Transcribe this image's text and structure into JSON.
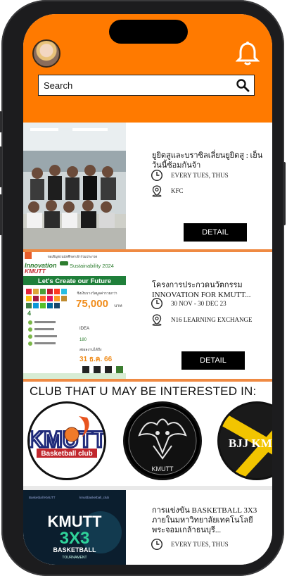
{
  "header": {
    "search_placeholder": "Search"
  },
  "events": [
    {
      "title": "ยูยิตสูและบราซิลเลี่ยนยูยิตสู : เย็นวันนี้ซ้อมกันจ้า",
      "time": "EVERY TUES, THUS",
      "location": "KFC",
      "button": "DETAIL"
    },
    {
      "title": "โครงการประกวดนวัตกรรม INNOVATION FOR KMUTT...",
      "time": "30 NOV - 30 DEC 23",
      "location": "N16 LEARNING EXCHANGE",
      "button": "DETAIL",
      "poster": {
        "heading": "Innovation for KMUTT Sustainability 2024",
        "banner": "Let's Create our Future",
        "prize": "75,000",
        "prize_unit": "บาท",
        "deadline": "31 ธ.ค. 66"
      }
    },
    {
      "title": "การแข่งขัน BASKETBALL 3X3 ภายในมหาวิทยาลัยเทคโนโลยีพระจอมเกล้าธนบุรี...",
      "time": "EVERY TUES, THUS",
      "poster": {
        "line1": "KMUTT",
        "line2": "3X3",
        "line3": "BASKETBALL",
        "line4": "TOURNAMENT"
      }
    }
  ],
  "clubs": {
    "heading": "CLUB THAT U MAY BE INTERESTED IN:",
    "items": [
      {
        "name": "Basketball club",
        "logo_text": "KMUTT"
      },
      {
        "name": "KMUTT",
        "logo_text": "KMUTT"
      },
      {
        "name": "BJJ KMU",
        "logo_text": "BJJ KMU"
      }
    ]
  },
  "colors": {
    "accent": "#ff7a00",
    "separator": "#ef8a43",
    "button": "#000000"
  }
}
